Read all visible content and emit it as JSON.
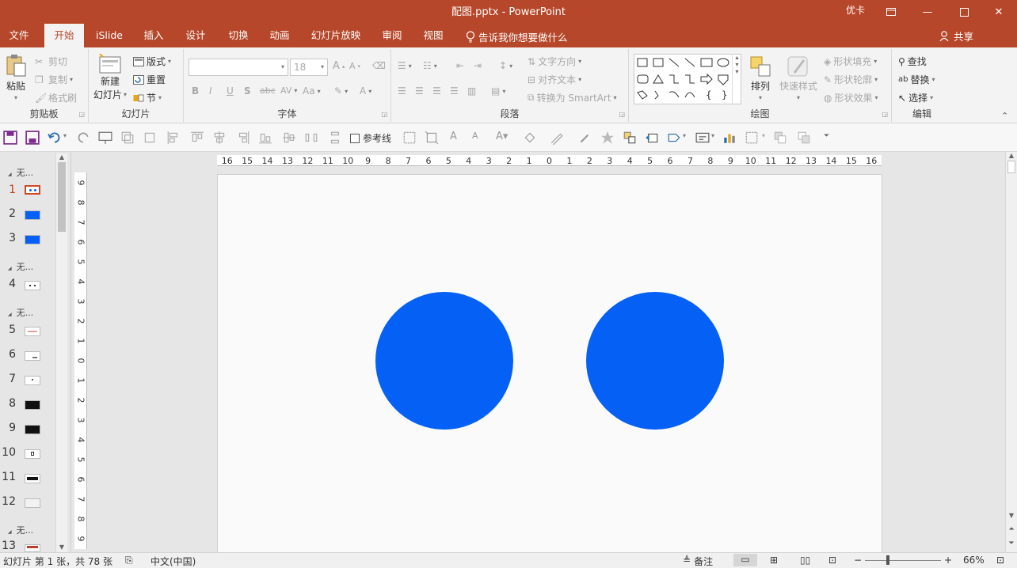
{
  "window": {
    "title": "配图.pptx - PowerPoint",
    "user": "优卡",
    "minimize": "—",
    "restore": "⧉",
    "close": "✕"
  },
  "tabs": [
    {
      "label": "文件"
    },
    {
      "label": "开始"
    },
    {
      "label": "iSlide"
    },
    {
      "label": "插入"
    },
    {
      "label": "设计"
    },
    {
      "label": "切换"
    },
    {
      "label": "动画"
    },
    {
      "label": "幻灯片放映"
    },
    {
      "label": "审阅"
    },
    {
      "label": "视图"
    }
  ],
  "tell_me": "告诉我你想要做什么",
  "share": "共享",
  "ribbon": {
    "clipboard": {
      "label": "剪贴板",
      "paste": "粘贴",
      "cut": "剪切",
      "copy": "复制",
      "format_painter": "格式刷"
    },
    "slides": {
      "label": "幻灯片",
      "new_slide_1": "新建",
      "new_slide_2": "幻灯片",
      "layout": "版式",
      "reset": "重置",
      "section": "节"
    },
    "font": {
      "label": "字体",
      "font_name": "",
      "font_size": "18",
      "bold": "B",
      "italic": "I",
      "underline": "U",
      "shadow": "S",
      "strike": "abc",
      "spacing": "AV",
      "case": "Aa",
      "font_color": "A"
    },
    "paragraph": {
      "label": "段落",
      "text_direction": "文字方向",
      "align_text": "对齐文本",
      "smartart": "转换为 SmartArt"
    },
    "drawing": {
      "label": "绘图",
      "arrange": "排列",
      "quick_styles": "快速样式",
      "shape_fill": "形状填充",
      "shape_outline": "形状轮廓",
      "shape_effects": "形状效果"
    },
    "editing": {
      "label": "编辑",
      "find": "查找",
      "replace": "替换",
      "select": "选择"
    }
  },
  "quick_toolbar": {
    "guides": "参考线"
  },
  "slide_panel": {
    "sections": [
      "无...",
      "无...",
      "无...",
      "无..."
    ],
    "slides": [
      "1",
      "2",
      "3",
      "4",
      "5",
      "6",
      "7",
      "8",
      "9",
      "10",
      "11",
      "12",
      "13"
    ]
  },
  "ruler": {
    "h_ticks": [
      "16",
      "15",
      "14",
      "13",
      "12",
      "11",
      "10",
      "9",
      "8",
      "7",
      "6",
      "5",
      "4",
      "3",
      "2",
      "1",
      "0",
      "1",
      "2",
      "3",
      "4",
      "5",
      "6",
      "7",
      "8",
      "9",
      "10",
      "11",
      "12",
      "13",
      "14",
      "15",
      "16"
    ],
    "v_ticks": [
      "9",
      "8",
      "7",
      "6",
      "5",
      "4",
      "3",
      "2",
      "1",
      "0",
      "1",
      "2",
      "3",
      "4",
      "5",
      "6",
      "7",
      "8",
      "9"
    ]
  },
  "slide": {
    "shape_color": "#0560f6",
    "shapes": [
      "circle-left",
      "circle-right"
    ]
  },
  "status": {
    "slide_info": "幻灯片 第 1 张，共 78 张",
    "language": "中文(中国)",
    "notes": "备注",
    "zoom": "66%",
    "zoom_minus": "−",
    "zoom_plus": "+"
  },
  "colors": {
    "accent": "#b7472a",
    "ribbon_bg": "#f3f3f3",
    "shape_blue": "#0560f6"
  }
}
